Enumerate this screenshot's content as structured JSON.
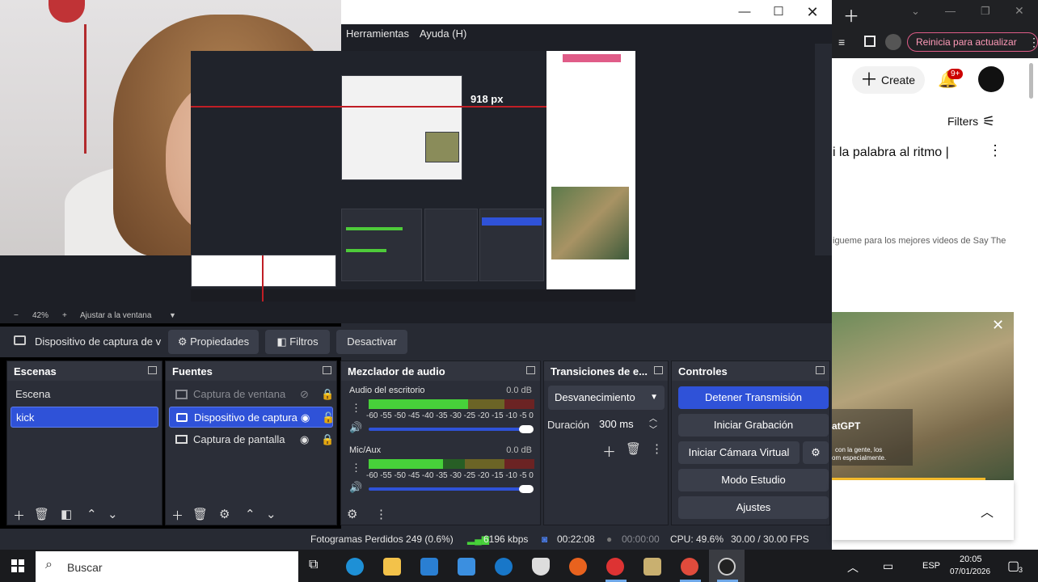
{
  "obs": {
    "menu": [
      "Herramientas",
      "Ayuda (H)"
    ],
    "zoom": {
      "minus": "−",
      "value": "42%",
      "plus": "+",
      "fit": "Ajustar a la ventana"
    },
    "source_toolbar": {
      "source_name": "Dispositivo de captura de v",
      "properties": "Propiedades",
      "filters": "Filtros",
      "deactivate": "Desactivar"
    },
    "scenes": {
      "title": "Escenas",
      "items": [
        "Escena",
        "kick"
      ]
    },
    "sources": {
      "title": "Fuentes",
      "items": [
        "Captura de ventana",
        "Dispositivo de captura",
        "Captura de pantalla"
      ]
    },
    "mixer": {
      "title": "Mezclador de audio",
      "channels": [
        {
          "name": "Audio del escritorio",
          "db": "0.0 dB",
          "level": 0.6
        },
        {
          "name": "Mic/Aux",
          "db": "0.0 dB",
          "level": 0.45
        }
      ],
      "scale": "-60 -55 -50 -45 -40 -35 -30 -25 -20 -15 -10 -5 0"
    },
    "transitions": {
      "title": "Transiciones de e...",
      "selected": "Desvanecimiento",
      "duration_label": "Duración",
      "duration_value": "300 ms"
    },
    "controls": {
      "title": "Controles",
      "stop_stream": "Detener Transmisión",
      "start_recording": "Iniciar Grabación",
      "start_virtual_cam": "Iniciar Cámara Virtual",
      "studio_mode": "Modo Estudio",
      "settings": "Ajustes"
    },
    "status": {
      "dropped": "Fotogramas Perdidos 249 (0.6%)",
      "bitrate": "6196 kbps",
      "stream_time": "00:22:08",
      "rec_time": "00:00:00",
      "cpu": "CPU: 49.6%",
      "fps": "30.00 / 30.00 FPS"
    },
    "preview_label": "918 px"
  },
  "browser": {
    "update_button": "Reinicia para actualizar",
    "create": "Create",
    "notif_badge": "9+",
    "filters": "Filters",
    "video_title": "i la palabra al ritmo |",
    "video_desc": "igueme para los mejores videos de Say The",
    "ad_line1": "atGPT",
    "ad_line2": "con la gente, los",
    "ad_line3": "om especialmente."
  },
  "taskbar": {
    "search_placeholder": "Buscar",
    "lang": "ESP",
    "time": "20:05",
    "date": "07/01/2026",
    "notif_count": "3"
  }
}
